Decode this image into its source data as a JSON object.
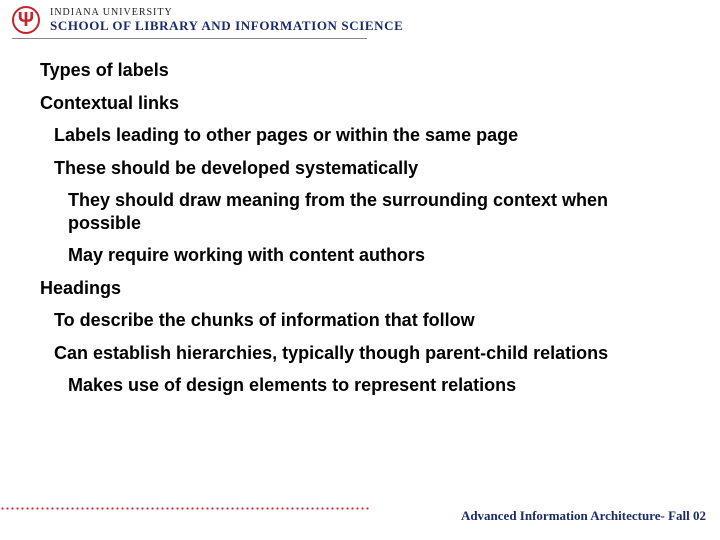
{
  "header": {
    "university": "INDIANA UNIVERSITY",
    "school": "SCHOOL OF LIBRARY AND INFORMATION SCIENCE",
    "logo_glyph": "Ψ"
  },
  "slide": {
    "title": "Types of labels",
    "section1": {
      "heading": "Contextual links",
      "p1": "Labels leading to other pages or within the same page",
      "p2": "These should be developed systematically",
      "sub1": "They should draw meaning from the surrounding context when possible",
      "sub2": "May require working with content authors"
    },
    "section2": {
      "heading": "Headings",
      "p1": "To describe the chunks of information that follow",
      "p2": "Can establish hierarchies, typically though parent-child relations",
      "sub1": "Makes use of design elements to represent relations"
    }
  },
  "footer": {
    "text": "Advanced Information Architecture- Fall 02"
  }
}
